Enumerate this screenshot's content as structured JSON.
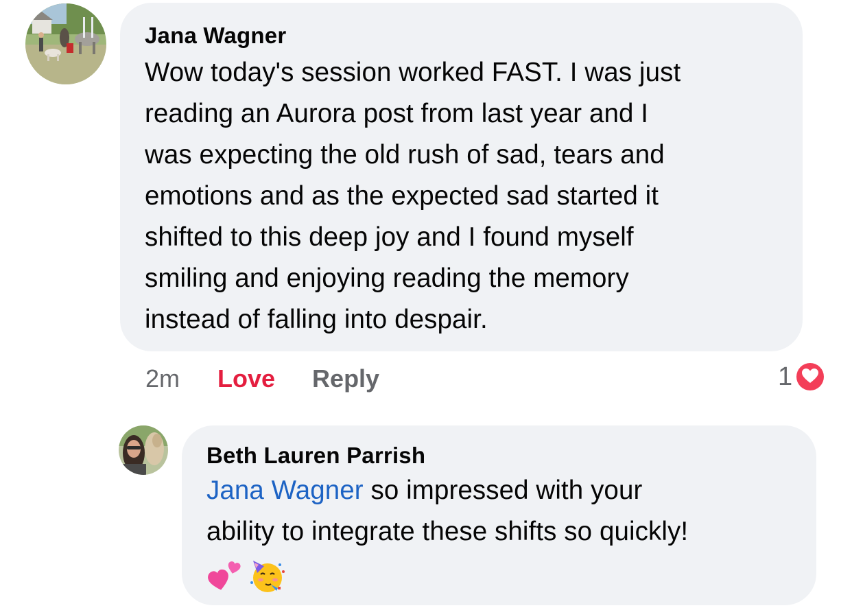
{
  "comments": [
    {
      "author": "Jana Wagner",
      "lines": [
        "Wow today's session worked FAST. I was just",
        "reading an Aurora post from last year and I",
        "was expecting the old rush of sad, tears and",
        "emotions and as the expected sad started it",
        "shifted to this deep joy and I found myself",
        "smiling and enjoying reading the memory",
        "instead of falling into despair."
      ],
      "time": "2m",
      "love_label": "Love",
      "reply_label": "Reply",
      "reaction_count": "1",
      "reaction_icon": "heart-icon",
      "reaction_color": "#f33e58"
    },
    {
      "author": "Beth Lauren Parrish",
      "mention": "Jana Wagner",
      "line1_rest": " so impressed with your",
      "line2": "ability to integrate these shifts so quickly!",
      "emojis": [
        "two-hearts-icon",
        "partying-face-icon"
      ],
      "mention_color": "#1d63c4"
    }
  ],
  "colors": {
    "bubble": "#f0f2f5",
    "secondary_text": "#65676b",
    "love_active": "#e41e3f"
  }
}
